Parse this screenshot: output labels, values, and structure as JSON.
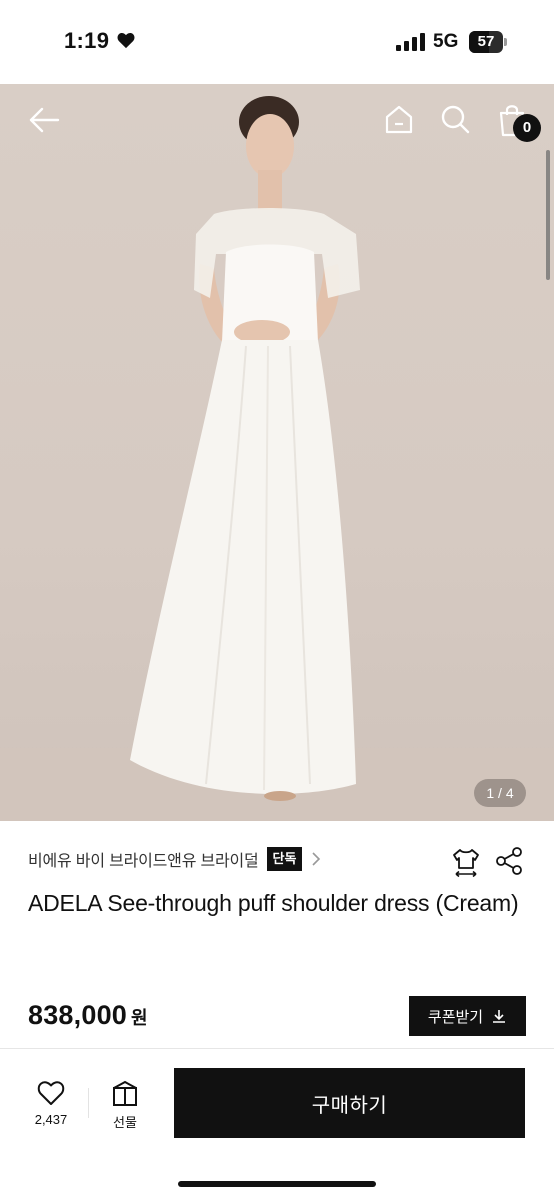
{
  "status_bar": {
    "time": "1:19",
    "network": "5G",
    "battery": "57"
  },
  "product_image": {
    "page_indicator": "1 / 4",
    "cart_count": "0",
    "background_color": "#d8cdc5",
    "dress_color": "#f7f5f1"
  },
  "product": {
    "brand": "비에유 바이 브라이드앤유 브라이덜",
    "badge": "단독",
    "title": "ADELA See-through puff shoulder dress (Cream)",
    "price": "838,000",
    "currency": "원",
    "coupon_label": "쿠폰받기"
  },
  "bottom_bar": {
    "wish_count": "2,437",
    "gift_label": "선물",
    "buy_label": "구매하기"
  },
  "icons": [
    "heart-icon",
    "signal-icon",
    "battery-icon",
    "back-arrow-icon",
    "home-icon",
    "search-icon",
    "shopping-bag-icon",
    "chevron-right-icon",
    "size-guide-icon",
    "share-icon",
    "download-icon",
    "gift-icon"
  ],
  "colors": {
    "primary": "#111111",
    "background": "#ffffff"
  }
}
